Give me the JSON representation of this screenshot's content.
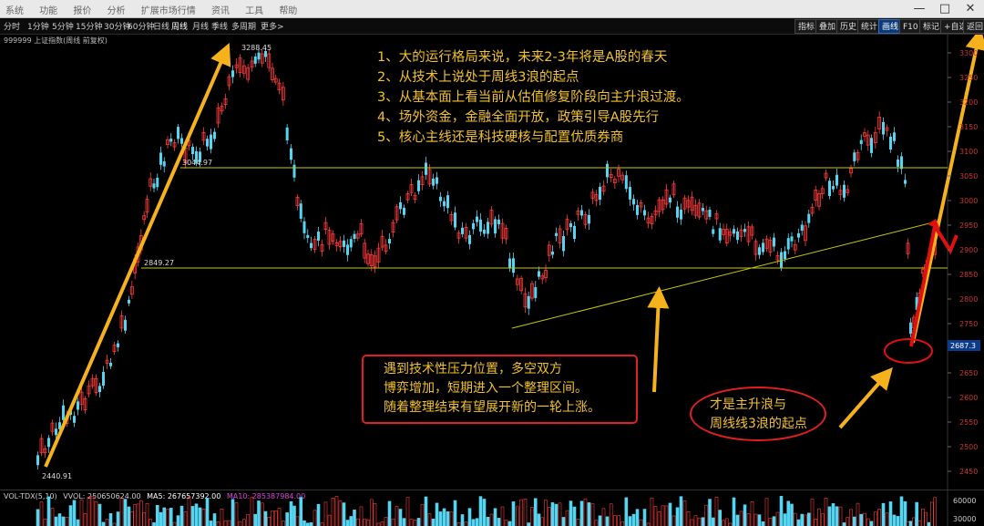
{
  "title_bar": {
    "menu": [
      "系统",
      "功能",
      "报价",
      "分析",
      "扩展市场行情",
      "资讯",
      "工具",
      "帮助"
    ],
    "minimize": "—",
    "maximize": "□",
    "close": "✕"
  },
  "toolbar": {
    "periods": [
      "分时",
      "1分钟",
      "5分钟",
      "15分钟",
      "30分钟",
      "60分钟",
      "日线",
      "周线",
      "月线",
      "季线",
      "多周期",
      "更多>"
    ],
    "active_period": "周线",
    "right_buttons": [
      "指标",
      "叠加",
      "历史",
      "统计",
      "画线",
      "F10",
      "标记",
      "+自选",
      "返回"
    ],
    "active_right": "画线"
  },
  "info_line": "999999 上证指数(周线 前复权)",
  "price_axis": {
    "ticks": [
      "3300",
      "3250",
      "3200",
      "3150",
      "3100",
      "3050",
      "3000",
      "2950",
      "2900",
      "2850",
      "2800",
      "2750",
      "2700",
      "2650",
      "2600",
      "2550",
      "2500",
      "2450"
    ],
    "current_price": "2687.3"
  },
  "price_markers": {
    "high": "3288.45",
    "low": "2440.91",
    "level_upper": "3044.97",
    "level_lower": "2849.27"
  },
  "notes": [
    "1、大的运行格局来说，未来2-3年将是A股的春天",
    "2、从技术上说处于周线3浪的起点",
    "3、从基本面上看当前从估值修复阶段向主升浪过渡。",
    "4、场外资金，金融全面开放，政策引导A股先行",
    "5、核心主线还是科技硬核与配置优质券商"
  ],
  "callout_consolidation": [
    "遇到技术性压力位置，多空双方",
    "博弈增加，短期进入一个整理区间。",
    "随着整理结束有望展开新的一轮上涨。"
  ],
  "callout_wave": [
    "才是主升浪与",
    "周线线3浪的起点"
  ],
  "volume": {
    "label": "VOL-TDX(5,10)",
    "vvol": "VVOL: 250650624.00",
    "ma5": "MA5: 267657392.00",
    "ma10": "MA10: 285387984.00",
    "ticks": [
      "60000",
      "30000"
    ]
  },
  "colors": {
    "up": "#ff3b3b",
    "down": "#54d6f2",
    "level_line": "#c8c800",
    "arrow": "#f6b21c",
    "arrow_red": "#e01010",
    "annotation_text": "#f2c12e",
    "volume_ma5": "#ffffff",
    "volume_ma10": "#e040e0"
  }
}
